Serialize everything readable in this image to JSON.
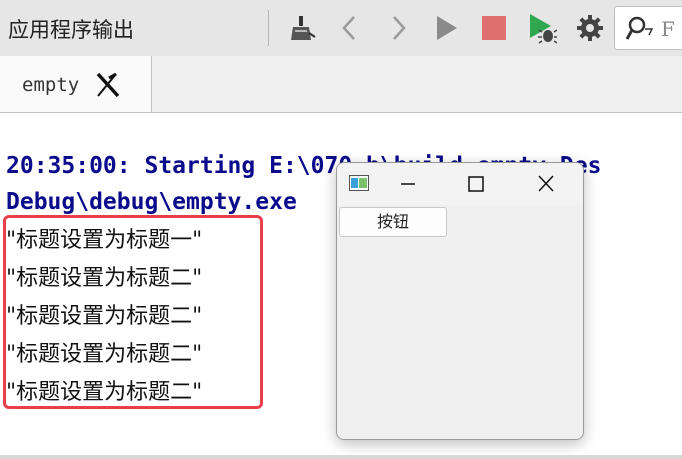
{
  "toolbar": {
    "panel_title": "应用程序输出",
    "icons": [
      "clean-broom-icon",
      "back-arrow-icon",
      "forward-arrow-icon",
      "run-icon",
      "stop-icon",
      "debug-run-icon",
      "settings-gear-icon"
    ],
    "colors": {
      "run": "#8a8a8a",
      "stop": "#e06c6c",
      "debug": "#2fa84f"
    },
    "filter_text": "F"
  },
  "tabs": [
    {
      "label": "empty"
    }
  ],
  "output": {
    "start_lines": [
      "20:35:00: Starting E:\\070_b\\build-empty-Des",
      "Debug\\debug\\empty.exe"
    ],
    "messages": [
      "\"标题设置为标题一\"",
      "\"标题设置为标题二\"",
      "\"标题设置为标题二\"",
      "\"标题设置为标题二\"",
      "\"标题设置为标题二\""
    ],
    "highlight_color": "#e8404a"
  },
  "window": {
    "button_label": "按钮"
  }
}
